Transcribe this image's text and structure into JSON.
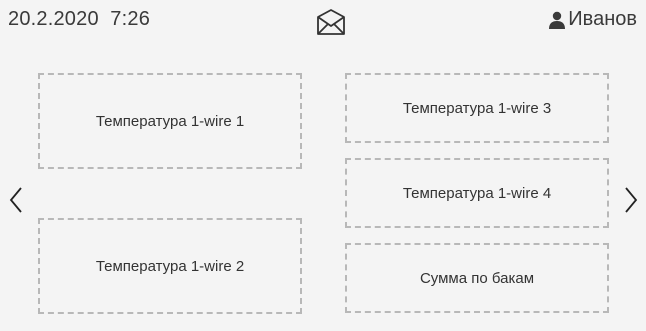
{
  "status_bar": {
    "datetime": "20.2.2020  7:26",
    "user_name": "Иванов",
    "mail_icon": "envelope-icon",
    "user_icon": "person-icon"
  },
  "navigation": {
    "prev_icon": "chevron-left-icon",
    "next_icon": "chevron-right-icon"
  },
  "tiles": [
    {
      "label": "Температура 1-wire 1"
    },
    {
      "label": "Температура 1-wire 2"
    },
    {
      "label": "Температура 1-wire 3"
    },
    {
      "label": "Температура 1-wire 4"
    },
    {
      "label": "Сумма по бакам"
    }
  ],
  "colors": {
    "background": "#f4f4f4",
    "text": "#333333",
    "tile_border": "#b8b8b8"
  }
}
